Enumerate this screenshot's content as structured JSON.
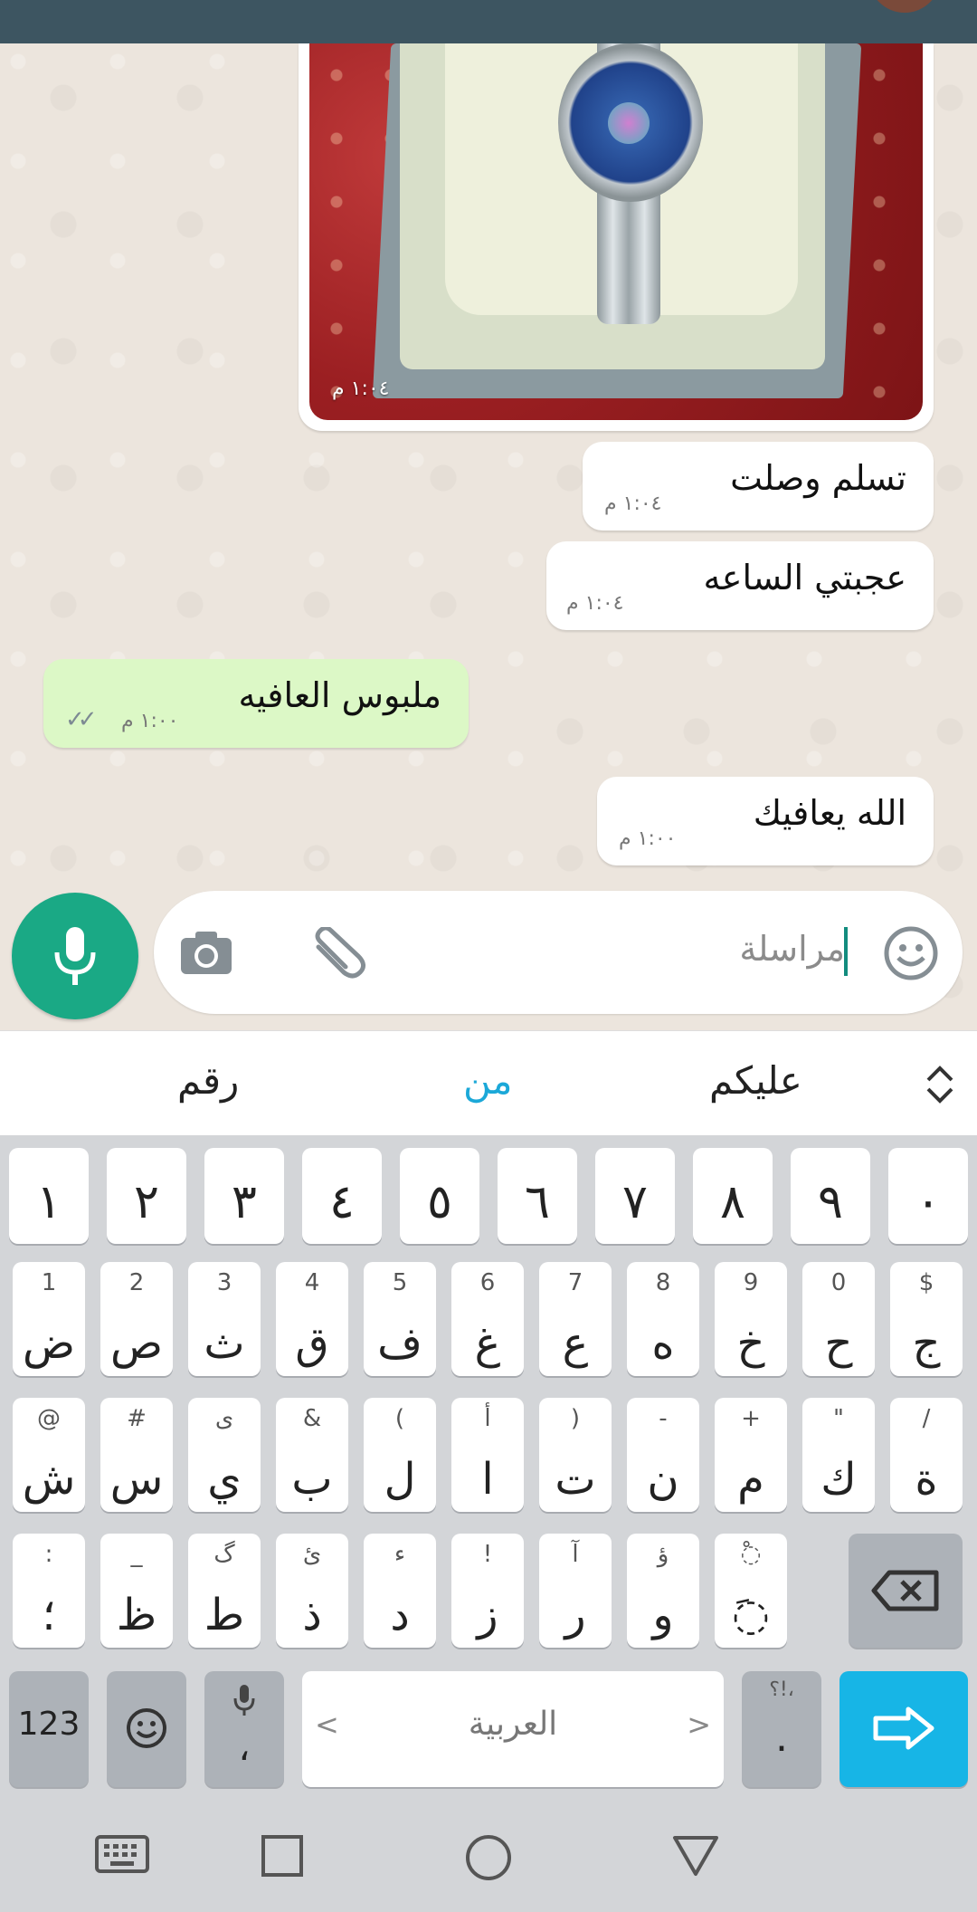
{
  "chat": {
    "image_message": {
      "time": "١:٠٤ م"
    },
    "messages": [
      {
        "text": "تسلم وصلت",
        "time": "١:٠٤ م",
        "direction": "in"
      },
      {
        "text": "عجبتي الساعه",
        "time": "١:٠٤ م",
        "direction": "in"
      },
      {
        "text": "ملبوس العافيه",
        "time": "١:٠٠ م",
        "direction": "out",
        "status": "read"
      },
      {
        "text": "الله يعافيك",
        "time": "١:٠٠ م",
        "direction": "in"
      }
    ]
  },
  "composer": {
    "placeholder": "مراسلة",
    "icons": [
      "emoji-icon",
      "paperclip-icon",
      "camera-icon",
      "mic-icon"
    ]
  },
  "suggestions": [
    "عليكم",
    "من",
    "رقم"
  ],
  "keyboard": {
    "number_row": [
      "١",
      "٢",
      "٣",
      "٤",
      "٥",
      "٦",
      "٧",
      "٨",
      "٩",
      "٠"
    ],
    "row1": [
      {
        "main": "ض",
        "sub": "1"
      },
      {
        "main": "ص",
        "sub": "2"
      },
      {
        "main": "ث",
        "sub": "3"
      },
      {
        "main": "ق",
        "sub": "4"
      },
      {
        "main": "ف",
        "sub": "5"
      },
      {
        "main": "غ",
        "sub": "6"
      },
      {
        "main": "ع",
        "sub": "7"
      },
      {
        "main": "ه",
        "sub": "8"
      },
      {
        "main": "خ",
        "sub": "9"
      },
      {
        "main": "ح",
        "sub": "0"
      },
      {
        "main": "ج",
        "sub": "$"
      }
    ],
    "row2": [
      {
        "main": "ش",
        "sub": "@"
      },
      {
        "main": "س",
        "sub": "#"
      },
      {
        "main": "ي",
        "sub": "ى"
      },
      {
        "main": "ب",
        "sub": "&"
      },
      {
        "main": "ل",
        "sub": "("
      },
      {
        "main": "ا",
        "sub": "أ"
      },
      {
        "main": "ت",
        "sub": ")"
      },
      {
        "main": "ن",
        "sub": "-"
      },
      {
        "main": "م",
        "sub": "+"
      },
      {
        "main": "ك",
        "sub": "\""
      },
      {
        "main": "ة",
        "sub": "/"
      }
    ],
    "row3": [
      {
        "main": "؛",
        "sub": ":"
      },
      {
        "main": "ظ",
        "sub": "_"
      },
      {
        "main": "ط",
        "sub": "گ"
      },
      {
        "main": "ذ",
        "sub": "ئ"
      },
      {
        "main": "د",
        "sub": "ء"
      },
      {
        "main": "ز",
        "sub": "!"
      },
      {
        "main": "ر",
        "sub": "آ"
      },
      {
        "main": "و",
        "sub": "ؤ"
      },
      {
        "main": "◌َ",
        "sub": "◌ْ"
      }
    ],
    "bottom": {
      "numbers_label": "123",
      "comma": "،",
      "space_label": "العربية",
      "space_left": "<",
      "space_right": ">",
      "period": ".",
      "period_sub": "؟!،"
    }
  },
  "colors": {
    "header": "#3d5561",
    "outgoing_bubble": "#dcf8c6",
    "mic_button": "#1aa985",
    "accent_suggestion": "#1ba8d8",
    "enter_key": "#17b5e6"
  }
}
